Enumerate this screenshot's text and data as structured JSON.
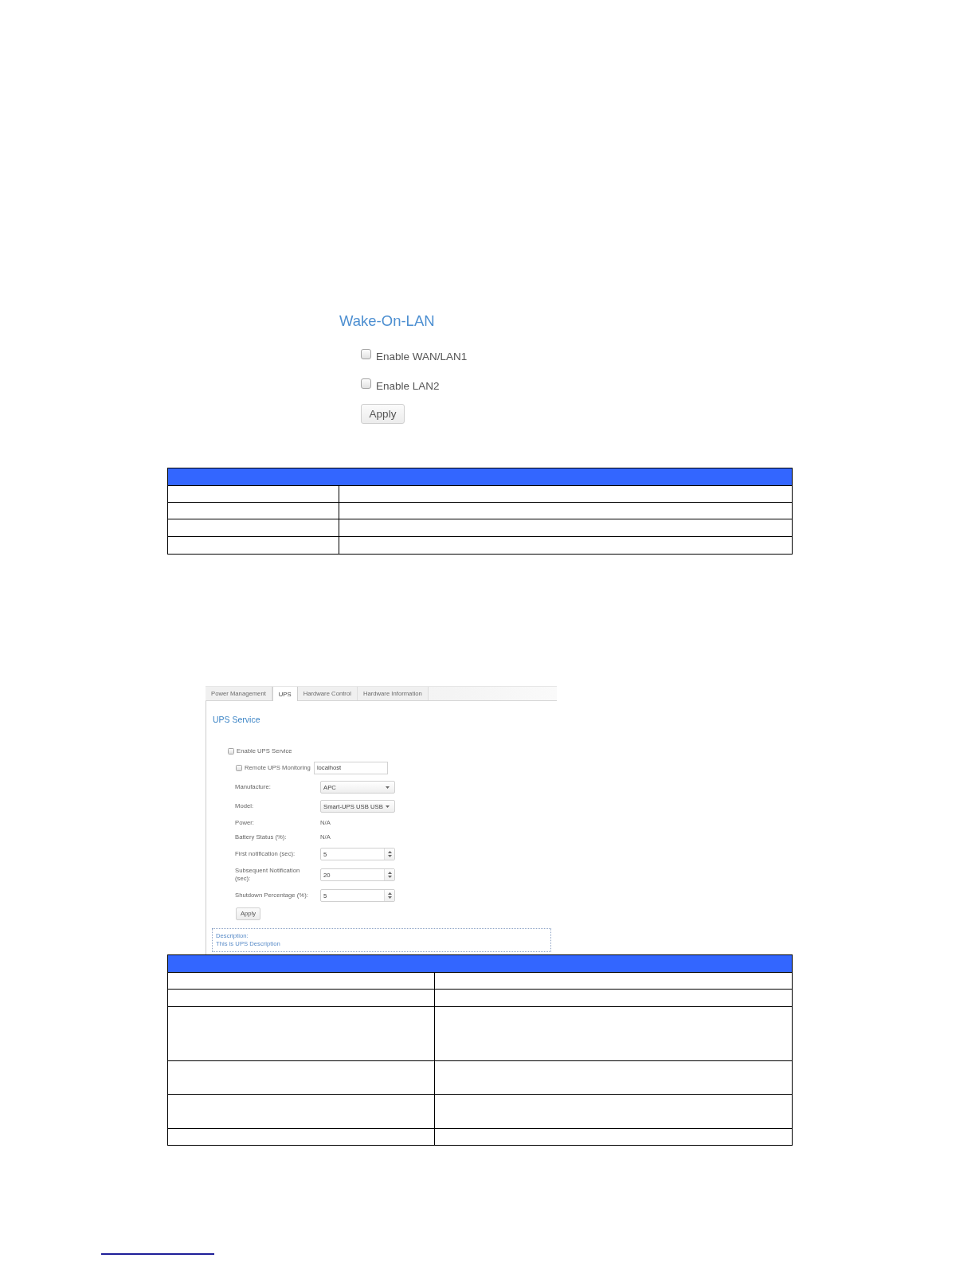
{
  "wake_on_lan": {
    "title": "Wake-On-LAN",
    "options": [
      {
        "label": "Enable WAN/LAN1",
        "checked": false
      },
      {
        "label": "Enable LAN2",
        "checked": false
      }
    ],
    "apply_button": "Apply"
  },
  "ups_screenshot": {
    "tabs": [
      {
        "label": "Power Management",
        "selected": false
      },
      {
        "label": "UPS",
        "selected": true
      },
      {
        "label": "Hardware Control",
        "selected": false
      },
      {
        "label": "Hardware Information",
        "selected": false
      }
    ],
    "title": "UPS Service",
    "enable_service": {
      "label": "Enable UPS Service",
      "checked": false
    },
    "remote_monitoring": {
      "label": "Remote UPS Monitoring",
      "checked": false,
      "value": "localhost"
    },
    "fields": [
      {
        "kind": "select",
        "label": "Manufacture:",
        "value": "APC"
      },
      {
        "kind": "select",
        "label": "Model:",
        "value": "Smart-UPS USB USB"
      },
      {
        "kind": "text",
        "label": "Power:",
        "value": "N/A"
      },
      {
        "kind": "text",
        "label": "Battery Status (%):",
        "value": "N/A"
      },
      {
        "kind": "spinner",
        "label": "First notification (sec):",
        "value": "5"
      },
      {
        "kind": "spinner",
        "label": "Subsequent Notification (sec):",
        "value": "20"
      },
      {
        "kind": "spinner",
        "label": "Shutdown Percentage (%):",
        "value": "5"
      }
    ],
    "apply_button": "Apply",
    "description": {
      "heading": "Description:",
      "text": "This is UPS Description"
    }
  }
}
